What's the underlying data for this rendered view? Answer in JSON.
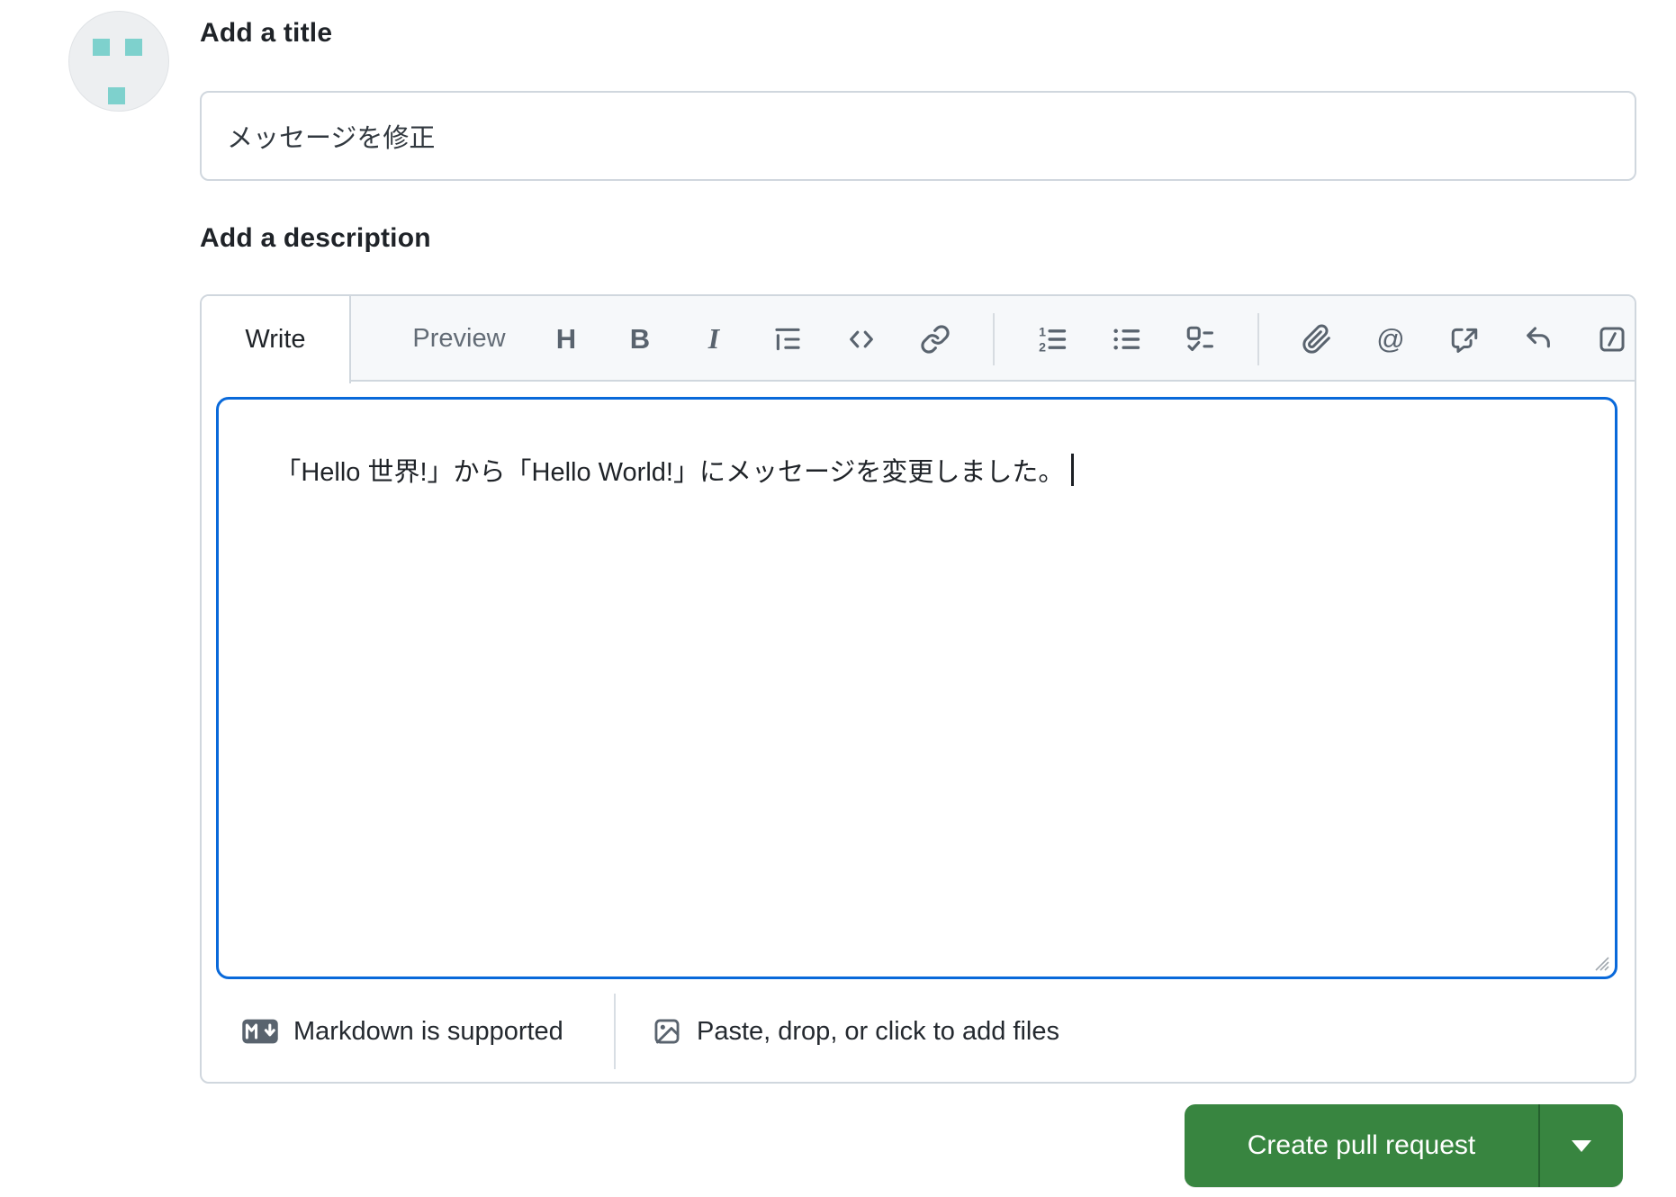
{
  "title_section": {
    "label": "Add a title",
    "value": "メッセージを修正"
  },
  "description_section": {
    "label": "Add a description",
    "tabs": {
      "write": "Write",
      "preview": "Preview"
    },
    "toolbar": {
      "heading_glyph": "H",
      "bold_glyph": "B",
      "italic_glyph": "I",
      "mention_glyph": "@",
      "ordered_list_numbers": {
        "first": "1",
        "second": "2"
      },
      "icon_names": [
        "heading",
        "bold",
        "italic",
        "quote",
        "code",
        "link",
        "ordered-list",
        "unordered-list",
        "task-list",
        "attach-file",
        "mention",
        "cross-reference",
        "saved-replies",
        "slash-commands"
      ]
    },
    "textarea": {
      "value": "「Hello 世界!」から「Hello World!」にメッセージを変更しました。"
    },
    "footer": {
      "markdown_note": "Markdown is supported",
      "attach_note": "Paste, drop, or click to add files"
    }
  },
  "actions": {
    "create_pull_request": "Create pull request"
  },
  "colors": {
    "button_green": "#388540",
    "focus_blue": "#0969da",
    "avatar_teal": "#7ed1cd",
    "border_gray": "#d0d7de",
    "tab_strip_bg": "#f6f8fa",
    "icon_gray": "#59636e"
  }
}
